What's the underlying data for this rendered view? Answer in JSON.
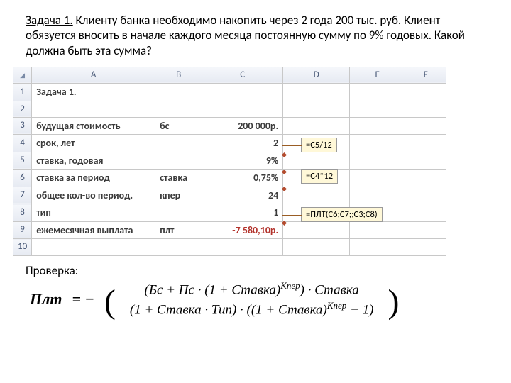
{
  "problem": {
    "title_underlined": "Задача 1.",
    "rest": " Клиенту банка необходимо накопить  через 2 года 200 тыс. руб. Клиент обязуется вносить в начале каждого месяца постоянную сумму по 9% годовых. Какой должна быть эта сумма?"
  },
  "headers": {
    "c0": "",
    "cA": "A",
    "cB": "B",
    "cC": "C",
    "cD": "D",
    "cE": "E",
    "cF": "F"
  },
  "rows": [
    {
      "n": "1",
      "a": "Задача 1.",
      "b": "",
      "c": "",
      "bold": true
    },
    {
      "n": "2",
      "a": "",
      "b": "",
      "c": ""
    },
    {
      "n": "3",
      "a": "будущая стоимость",
      "b": "бс",
      "c": "200 000р.",
      "bold": true
    },
    {
      "n": "4",
      "a": "срок, лет",
      "b": "",
      "c": "2",
      "bold": true
    },
    {
      "n": "5",
      "a": "ставка, годовая",
      "b": "",
      "c": "9%",
      "bold": true
    },
    {
      "n": "6",
      "a": "ставка за период",
      "b": "ставка",
      "c": "0,75%",
      "bold": true
    },
    {
      "n": "7",
      "a": "общее кол-во период.",
      "b": "кпер",
      "c": "24",
      "bold": true
    },
    {
      "n": "8",
      "a": "тип",
      "b": "",
      "c": "1",
      "bold": true
    },
    {
      "n": "9",
      "a": "ежемесячная выплата",
      "b": "плт",
      "c": "-7 580,10р.",
      "bold": true,
      "red": true
    },
    {
      "n": "10",
      "a": "",
      "b": "",
      "c": ""
    }
  ],
  "callouts": {
    "c1": "=C5/12",
    "c2": "=C4*12",
    "c3": "=ПЛТ(C6;C7;;C3;C8)"
  },
  "verify": "Проверка:",
  "formula": {
    "lhs": "Плт",
    "num": "(Бс + Пс · (1 + Ставка)<sup class='sup'>Кпер</sup>) · Ставка",
    "den": "(1 + Ставка · Тип) · ((1 + Ставка)<sup class='sup'>Кпер</sup> − 1)"
  },
  "chart_data": {
    "type": "table",
    "title": "Excel worksheet fragment",
    "columns": [
      "A",
      "B",
      "C"
    ],
    "rows": [
      [
        "Задача 1.",
        "",
        ""
      ],
      [
        "",
        "",
        ""
      ],
      [
        "будущая стоимость",
        "бс",
        "200 000р."
      ],
      [
        "срок, лет",
        "",
        "2"
      ],
      [
        "ставка, годовая",
        "",
        "9%"
      ],
      [
        "ставка за период",
        "ставка",
        "0,75%"
      ],
      [
        "общее кол-во период.",
        "кпер",
        "24"
      ],
      [
        "тип",
        "",
        "1"
      ],
      [
        "ежемесячная выплата",
        "плт",
        "-7 580,10р."
      ]
    ],
    "formulas": {
      "C6": "=C5/12",
      "C7": "=C4*12",
      "C9": "=ПЛТ(C6;C7;;C3;C8)"
    }
  }
}
